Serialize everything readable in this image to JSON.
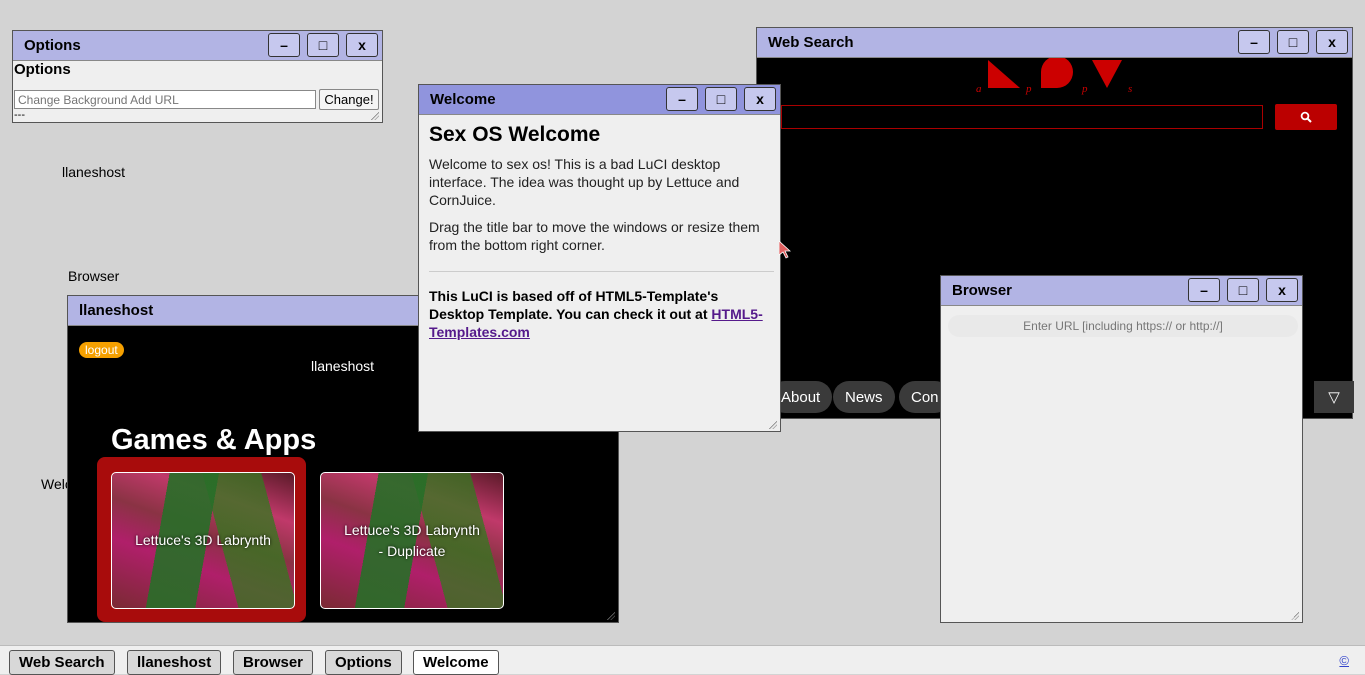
{
  "desktop": {
    "icons": [
      "llaneshost",
      "Browser",
      "Welc"
    ]
  },
  "options_window": {
    "title": "Options",
    "heading": "Options",
    "bg_input_placeholder": "Change Background Add URL",
    "change_button": "Change!",
    "status": "---"
  },
  "search_window": {
    "title": "Web Search",
    "logo_letters": [
      "a",
      "p",
      "p",
      "s"
    ],
    "search_icon": "search-icon",
    "nav_links": [
      "About",
      "News",
      "Con"
    ],
    "menu_icon": "▽"
  },
  "host_window": {
    "title": "llaneshost",
    "logout": "logout",
    "host_label": "llaneshost",
    "section_title": "Games & Apps",
    "apps": [
      {
        "name": "Lettuce's 3D Labrynth"
      },
      {
        "name": "Lettuce's 3D Labrynth - Duplicate"
      }
    ]
  },
  "welcome_window": {
    "title": "Welcome",
    "heading": "Sex OS Welcome",
    "para1": "Welcome to sex os! This is a bad LuCI desktop interface. The idea was thought up by Lettuce and CornJuice.",
    "para2": "Drag the title bar to move the windows or resize them from the bottom right corner.",
    "credit": "This LuCI is based off of HTML5-Template's Desktop Template. You can check it out at",
    "credit_link": "HTML5-Templates.com"
  },
  "browser_window": {
    "title": "Browser",
    "url_placeholder": "Enter URL [including https:// or http://]"
  },
  "window_controls": {
    "minimize": "–",
    "maximize": "□",
    "close": "x"
  },
  "taskbar": {
    "items": [
      "Web Search",
      "llaneshost",
      "Browser",
      "Options",
      "Welcome"
    ],
    "active": "Welcome",
    "copyright": "©"
  },
  "colors": {
    "titlebar": "#b2b4e4",
    "titlebar_active": "#9094dd",
    "brand_red": "#bb0000",
    "logout_orange": "#f5a000"
  }
}
